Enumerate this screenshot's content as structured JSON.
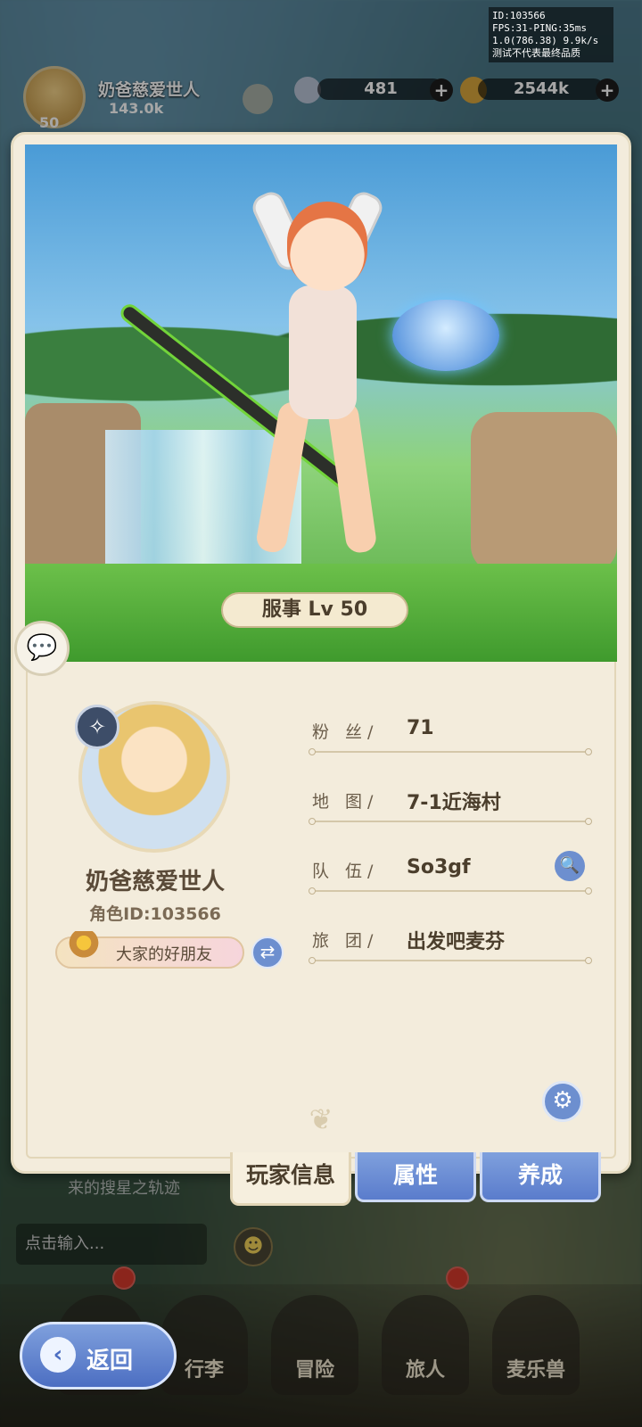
{
  "debug": {
    "lines": [
      "ID:103566",
      "FPS:31-PING:35ms",
      "1.0(786.38) 9.9k/s",
      "测试不代表最终品质"
    ]
  },
  "hud": {
    "player_name": "奶爸慈爱世人",
    "power": "143.0k",
    "level": "50",
    "resource1": "481",
    "resource2": "2544k"
  },
  "character": {
    "level_badge": "服事 Lv 50"
  },
  "profile": {
    "name": "奶爸慈爱世人",
    "role_id": "角色ID:103566",
    "title": "大家的好朋友"
  },
  "info": {
    "fans_label": "粉 丝/",
    "fans_value": "71",
    "map_label": "地 图/",
    "map_value": "7-1近海村",
    "team_label": "队 伍/",
    "team_value": "So3gf",
    "guild_label": "旅 团/",
    "guild_value": "出发吧麦芬"
  },
  "tabs": {
    "player_info": "玩家信息",
    "attributes": "属性",
    "develop": "养成"
  },
  "bottom": {
    "quest_text": "来的搜星之轨迹",
    "chat_placeholder": "点击输入...",
    "nav": [
      "行李",
      "冒险",
      "旅人",
      "麦乐兽"
    ],
    "back": "返回"
  },
  "colors": {
    "panel": "#f3ecdc",
    "accent_blue": "#6d8fcf",
    "text_brown": "#4b3e2c"
  }
}
